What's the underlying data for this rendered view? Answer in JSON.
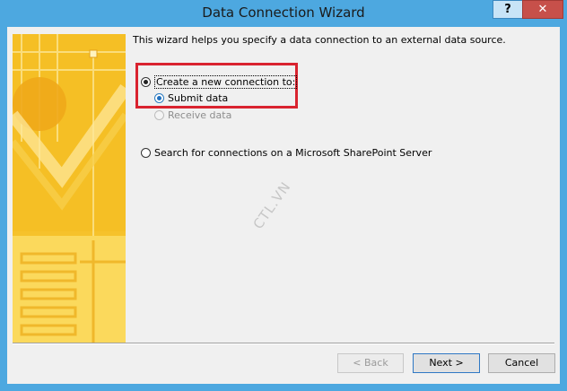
{
  "window": {
    "title": "Data Connection Wizard",
    "help_label": "?",
    "close_label": "✕"
  },
  "intro_text": "This wizard helps you specify a data connection to an external data source.",
  "options": {
    "create_new": "Create a new connection to:",
    "submit_data": "Submit data",
    "receive_data": "Receive data",
    "search_sharepoint": "Search for connections on a Microsoft SharePoint Server"
  },
  "watermark": "CTL.VN",
  "buttons": {
    "back": "< Back",
    "next": "Next >",
    "cancel": "Cancel"
  },
  "colors": {
    "title_bar": "#4da8e0",
    "highlight_box": "#d9232f",
    "art_background": "#f7c532"
  }
}
